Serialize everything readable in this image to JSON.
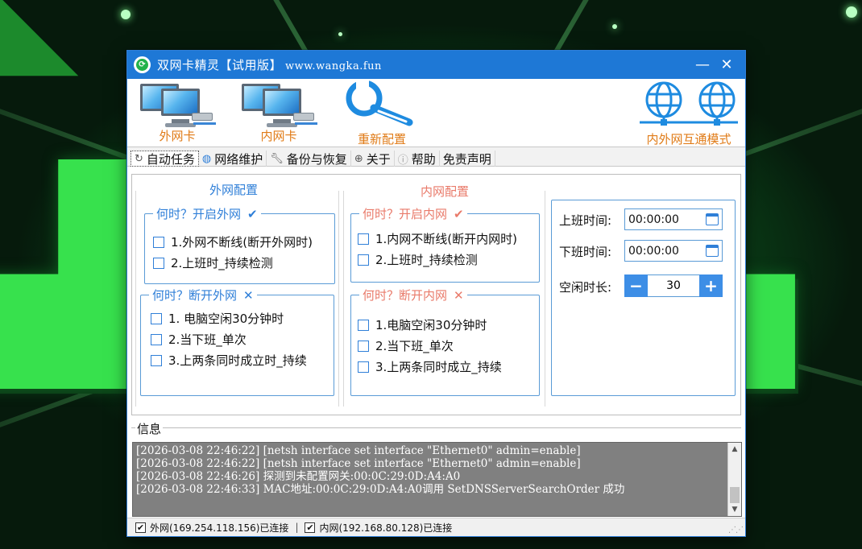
{
  "window": {
    "title": "双网卡精灵【试用版】",
    "url": "www.wangka.fun",
    "minimize_glyph": "—",
    "close_glyph": "✕"
  },
  "toolbar": {
    "outer_nic": "外网卡",
    "inner_nic": "内网卡",
    "reconfigure": "重新配置",
    "interconnect": "内外网互通模式"
  },
  "tabs": [
    {
      "label": "自动任务",
      "icon": "refresh-icon"
    },
    {
      "label": "网络维护",
      "icon": "globe-icon"
    },
    {
      "label": "备份与恢复",
      "icon": "wrench-icon"
    },
    {
      "label": "关于",
      "icon": "globe-icon"
    },
    {
      "label": "帮助",
      "icon": "help-icon"
    },
    {
      "label": "免责声明",
      "icon": ""
    }
  ],
  "outer": {
    "title": "外网配置",
    "open_legend": "何时？开启外网",
    "open_items": [
      "1.外网不断线(断开外网时)",
      "2.上班时_持续检测"
    ],
    "close_legend": "何时？断开外网",
    "close_items": [
      "1. 电脑空闲30分钟时",
      "2.当下班_单次",
      "3.上两条同时成立时_持续"
    ]
  },
  "inner": {
    "title": "内网配置",
    "open_legend": "何时？开启内网",
    "open_items": [
      "1.内网不断线(断开内网时)",
      "2.上班时_持续检测"
    ],
    "close_legend": "何时？断开内网",
    "close_items": [
      "1.电脑空闲30分钟时",
      "2.当下班_单次",
      "3.上两条同时成立_持续"
    ]
  },
  "schedule": {
    "work_start_label": "上班时间:",
    "work_start_value": "00:00:00",
    "work_end_label": "下班时间:",
    "work_end_value": "00:00:00",
    "idle_label": "空闲时长:",
    "idle_value": "30",
    "minus": "−",
    "plus": "+"
  },
  "info": {
    "label": "信息",
    "log": [
      "[2026-03-08 22:46:22] [netsh interface set interface \"Ethernet0\" admin=enable]",
      "[2026-03-08 22:46:22] [netsh interface set interface \"Ethernet0\" admin=enable]",
      "[2026-03-08 22:46:26] 探测到未配置网关:00:0C:29:0D:A4:A0",
      "[2026-03-08 22:46:33] MAC地址:00:0C:29:0D:A4:A0调用 SetDNSServerSearchOrder 成功"
    ]
  },
  "status": {
    "outer": "外网(169.254.118.156)已连接",
    "separator": "|",
    "inner": "内网(192.168.80.128)已连接",
    "check": "✔"
  },
  "colors": {
    "accent": "#1e78d6",
    "orange": "#e07b17",
    "group_border": "#5a9bd6",
    "red_x": "#e97a6a"
  }
}
